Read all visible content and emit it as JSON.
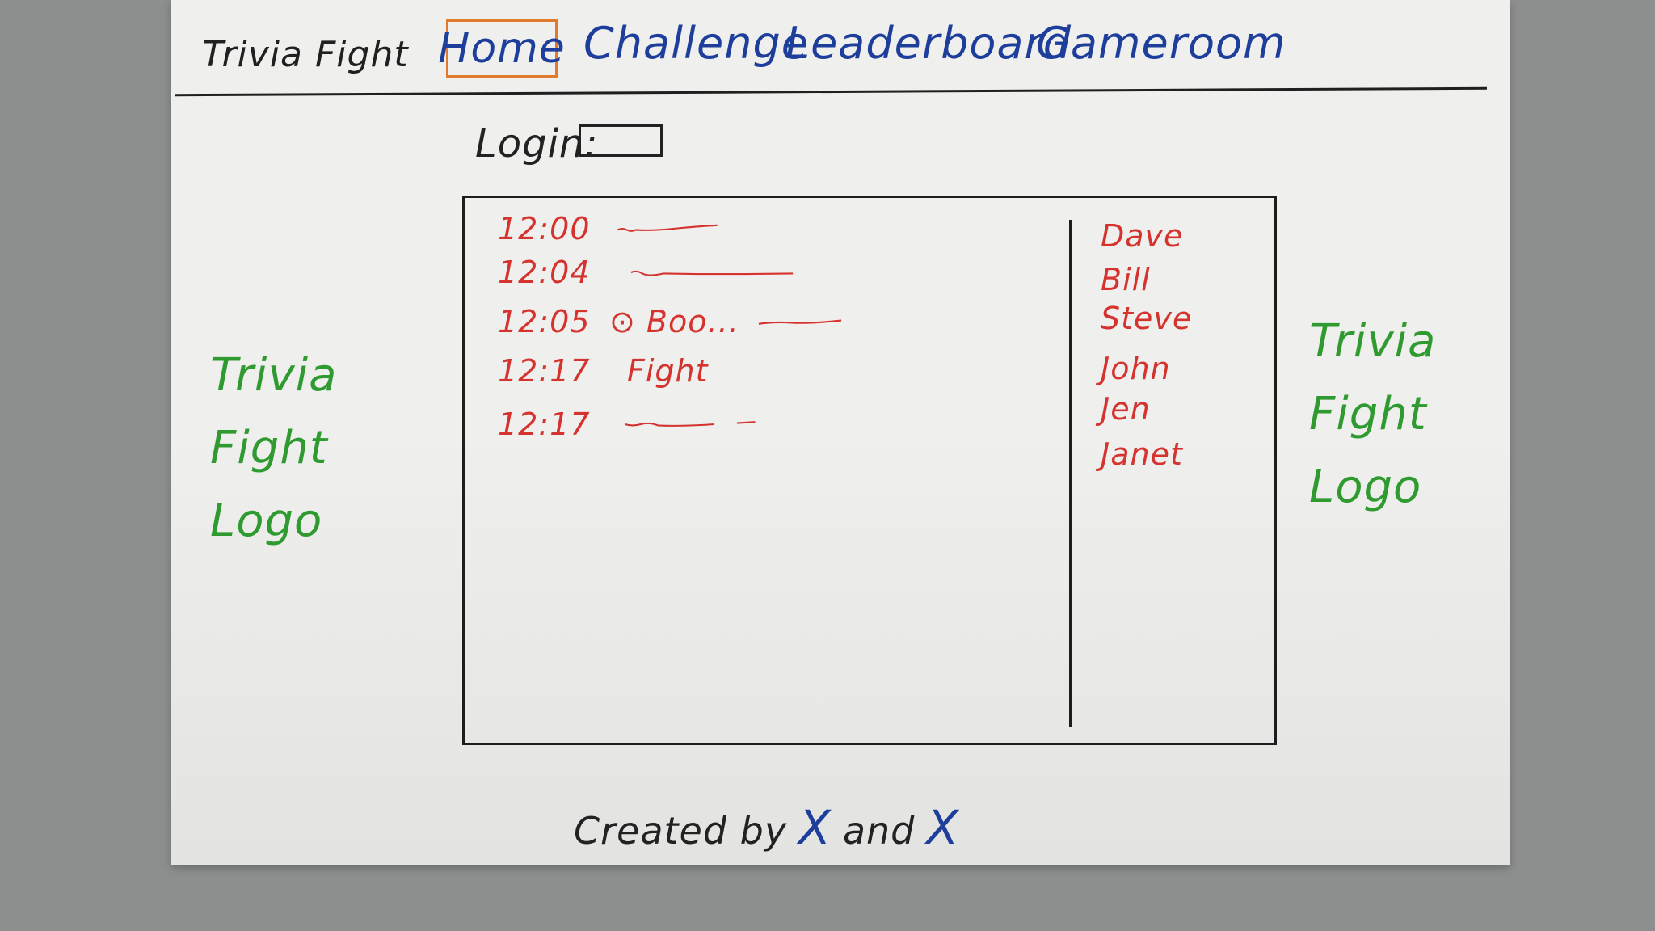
{
  "header": {
    "site_title": "Trivia Fight",
    "nav": [
      {
        "label": "Home",
        "active": true
      },
      {
        "label": "Challenge"
      },
      {
        "label": "Leaderboard"
      },
      {
        "label": "Gameroom"
      }
    ]
  },
  "login": {
    "label": "Login:",
    "value": ""
  },
  "chat": {
    "messages": [
      {
        "time": "12:00",
        "text": ""
      },
      {
        "time": "12:04",
        "text": ""
      },
      {
        "time": "12:05",
        "text": "⊙ Boo..."
      },
      {
        "time": "12:17",
        "text": "Fight"
      },
      {
        "time": "12:17",
        "text": ""
      }
    ],
    "users": [
      "Dave",
      "Bill",
      "Steve",
      "John",
      "Jen",
      "Janet"
    ]
  },
  "logos": {
    "left": [
      "Trivia",
      "Fight",
      "Logo"
    ],
    "right": [
      "Trivia",
      "Fight",
      "Logo"
    ]
  },
  "footer": {
    "created_by": "Created by",
    "author1": "X",
    "and": "and",
    "author2": "X"
  },
  "colors": {
    "nav": "#1e3e9c",
    "chat": "#d5332e",
    "logo": "#2f9a2f",
    "active_border": "#e07b2e"
  }
}
